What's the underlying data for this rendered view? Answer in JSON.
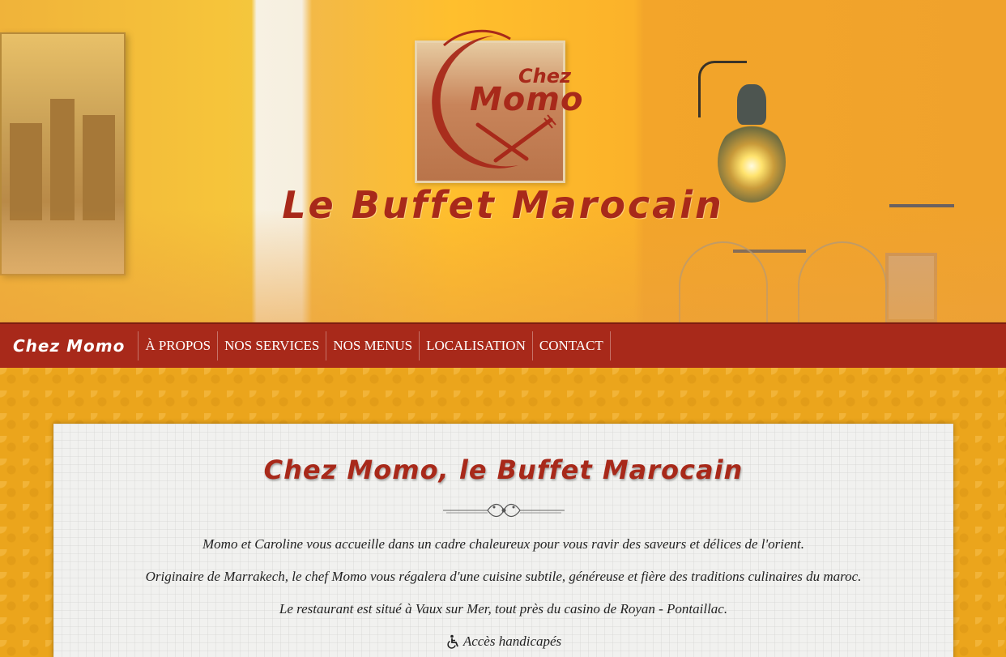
{
  "hero": {
    "logo_chez": "Chez",
    "logo_momo": "Momo",
    "title": "Le Buffet Marocain"
  },
  "navbar": {
    "brand": "Chez Momo",
    "items": [
      {
        "label": "À PROPOS"
      },
      {
        "label": "NOS SERVICES"
      },
      {
        "label": "NOS MENUS"
      },
      {
        "label": "LOCALISATION"
      },
      {
        "label": "CONTACT"
      }
    ]
  },
  "content": {
    "title": "Chez Momo, le Buffet Marocain",
    "paragraphs": [
      "Momo et Caroline vous accueille dans un cadre chaleureux pour vous ravir des saveurs et délices de l'orient.",
      "Originaire de Marrakech, le chef Momo vous régalera d'une cuisine subtile, généreuse et fière des traditions culinaires du maroc.",
      "Le restaurant est situé à Vaux sur Mer, tout près du casino de Royan - Pontaillac."
    ],
    "accessibility": "Accès handicapés",
    "accessibility_icon": "wheelchair-icon"
  },
  "colors": {
    "brand_red": "#a8291a",
    "background_orange": "#eba51c",
    "card_bg": "#f1f1ef"
  }
}
